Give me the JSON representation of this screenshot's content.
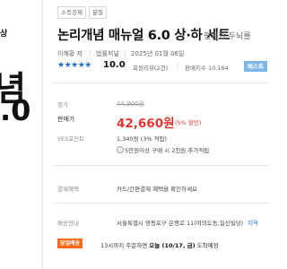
{
  "cover": {
    "tab": "상",
    "big_line1": "념",
    "big_line2": ".0"
  },
  "tags": [
    "소득공제",
    "분철"
  ],
  "title": "논리개념 매뉴얼 6.0 상·하 세트",
  "title_sub": "평범한 두뇌를",
  "author": "이해황 저",
  "publisher": "법률저널",
  "date": "2025년 01월 06일",
  "rating": {
    "stars": 5,
    "value": "10.0",
    "review": "회원리뷰(2건)",
    "sales_index": "판매지수 10,164",
    "badge": "베스트"
  },
  "price": {
    "list_label": "정가",
    "list_price": "44,900원",
    "sale_label": "판매가",
    "sale_price": "42,660원",
    "discount": "(5% 할인)"
  },
  "points": {
    "label": "YES포인트",
    "value": "1,340원 (3% 적립)",
    "note": "5만원이상 구매 시 2천원 추가적립"
  },
  "payment": {
    "label": "결제혜택",
    "text": "카드/간편결제 혜택을 확인하세요"
  },
  "shipping": {
    "label": "배송안내",
    "address": "서울특별시 영등포구 은행로 11(여의도동,일신빌딩)",
    "link": "지역"
  },
  "same_day": {
    "badge": "당일배송",
    "text_prefix": "13시까지 주문하면",
    "text_bold": "오늘 (10/17, 금)",
    "text_suffix": "도착예정"
  },
  "colors": {
    "accent_red": "#e8342e",
    "star_blue": "#1f6fd6",
    "badge_orange": "#ff6a1a",
    "best_blue": "#7fb6ea"
  }
}
